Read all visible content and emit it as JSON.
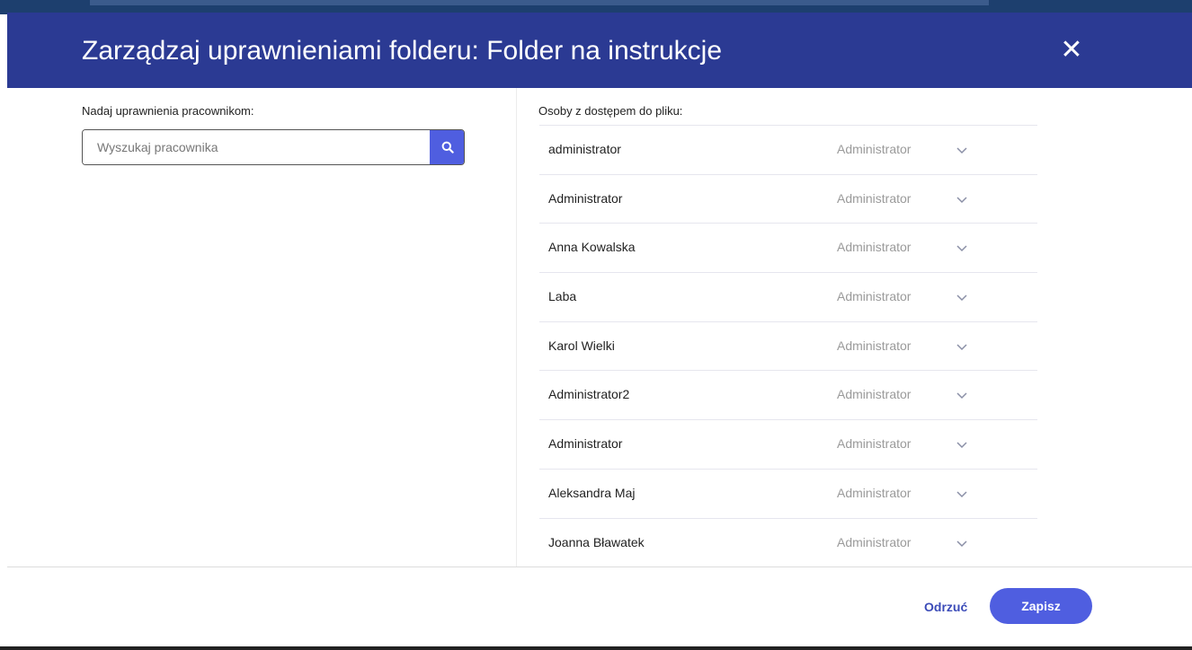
{
  "dialog": {
    "title": "Zarządzaj uprawnieniami folderu: Folder na instrukcje",
    "close_icon": "close-icon",
    "header_color": "#2b3a93"
  },
  "left": {
    "label": "Nadaj uprawnienia pracownikom:",
    "search_placeholder": "Wyszukaj pracownika",
    "search_value": "",
    "search_icon": "search-icon",
    "accent_color": "#4f5ee0"
  },
  "right": {
    "label": "Osoby z dostępem do pliku:",
    "people": [
      {
        "name": "administrator",
        "role": "Administrator"
      },
      {
        "name": "Administrator",
        "role": "Administrator"
      },
      {
        "name": "Anna Kowalska",
        "role": "Administrator"
      },
      {
        "name": "Laba",
        "role": "Administrator"
      },
      {
        "name": "Karol Wielki",
        "role": "Administrator"
      },
      {
        "name": "Administrator2",
        "role": "Administrator"
      },
      {
        "name": "Administrator",
        "role": "Administrator"
      },
      {
        "name": "Aleksandra Maj",
        "role": "Administrator"
      },
      {
        "name": "Joanna Bławatek",
        "role": "Administrator"
      }
    ]
  },
  "footer": {
    "discard_label": "Odrzuć",
    "save_label": "Zapisz"
  }
}
